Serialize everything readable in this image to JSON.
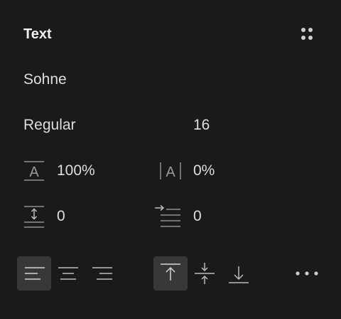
{
  "panel": {
    "title": "Text"
  },
  "font": {
    "family": "Sohne",
    "weight": "Regular",
    "size": "16"
  },
  "metrics": {
    "line_height": "100%",
    "letter_spacing": "0%",
    "paragraph_spacing": "0",
    "paragraph_indent": "0"
  },
  "alignment": {
    "horizontal": [
      "left",
      "center",
      "right"
    ],
    "horizontal_selected": "left",
    "vertical": [
      "top",
      "middle",
      "bottom"
    ],
    "vertical_selected": "top"
  },
  "icons": {
    "menu": "grid-dots-icon",
    "line_height": "line-height-icon",
    "letter_spacing": "letter-spacing-icon",
    "paragraph_spacing": "paragraph-spacing-icon",
    "paragraph_indent": "paragraph-indent-icon",
    "more": "more-horizontal-icon"
  },
  "colors": {
    "background": "#1a1a1a",
    "text": "#dedede",
    "icon": "#bdbdbd",
    "active_button": "#383838"
  }
}
